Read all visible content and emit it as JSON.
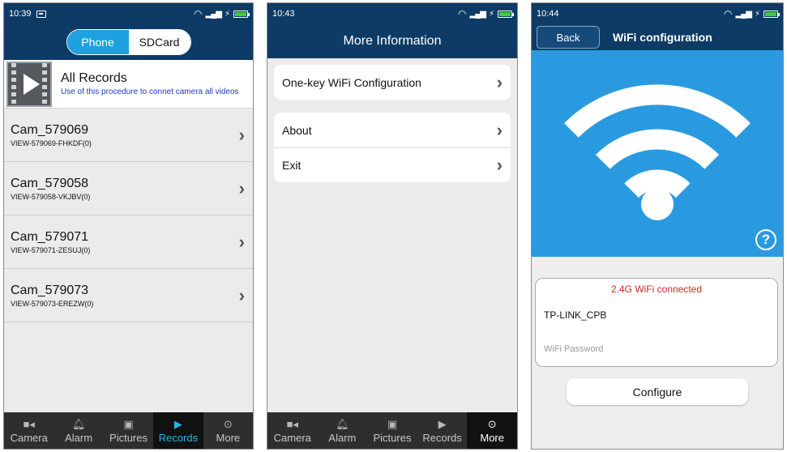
{
  "colors": {
    "header": "#0d3b66",
    "accent": "#1da1e0",
    "active_tab": "#26b4e8",
    "hero": "#2a9ae0",
    "error": "#d22b1f",
    "link": "#1a39c8"
  },
  "panel1": {
    "status_time": "10:39",
    "segment": {
      "phone": "Phone",
      "sdcard": "SDCard",
      "selected": "Phone"
    },
    "all_records": {
      "title": "All Records",
      "subtitle": "Use of this procedure to connet camera all videos"
    },
    "cameras": [
      {
        "name": "Cam_579069",
        "id": "VIEW-579069-FHKDF(0)"
      },
      {
        "name": "Cam_579058",
        "id": "VIEW-579058-VKJBV(0)"
      },
      {
        "name": "Cam_579071",
        "id": "VIEW-579071-ZESUJ(0)"
      },
      {
        "name": "Cam_579073",
        "id": "VIEW-579073-EREZW(0)"
      }
    ],
    "active_tab": "Records"
  },
  "panel2": {
    "status_time": "10:43",
    "title": "More Information",
    "group1": [
      "One-key WiFi Configuration"
    ],
    "group2": [
      "About",
      "Exit"
    ],
    "active_tab": "More"
  },
  "panel3": {
    "status_time": "10:44",
    "back_label": "Back",
    "title": "WiFi configuration",
    "connection_status": "2.4G WiFi connected",
    "ssid": "TP-LINK_CPB",
    "password_placeholder": "WiFi Password",
    "configure_label": "Configure"
  },
  "tabs": [
    {
      "label": "Camera",
      "icon": "camera-icon"
    },
    {
      "label": "Alarm",
      "icon": "bell-icon"
    },
    {
      "label": "Pictures",
      "icon": "image-icon"
    },
    {
      "label": "Records",
      "icon": "play-icon"
    },
    {
      "label": "More",
      "icon": "more-icon"
    }
  ]
}
